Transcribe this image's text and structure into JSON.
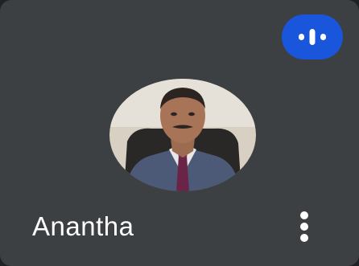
{
  "tile": {
    "participant_name": "Anantha",
    "speaking_indicator_icon": "audio-bars-icon",
    "more_options_icon": "more-vert-icon"
  },
  "colors": {
    "tile_background": "#3c4043",
    "name_text": "#ffffff",
    "speaking_badge": "#1a56db",
    "icon_white": "#ffffff"
  }
}
